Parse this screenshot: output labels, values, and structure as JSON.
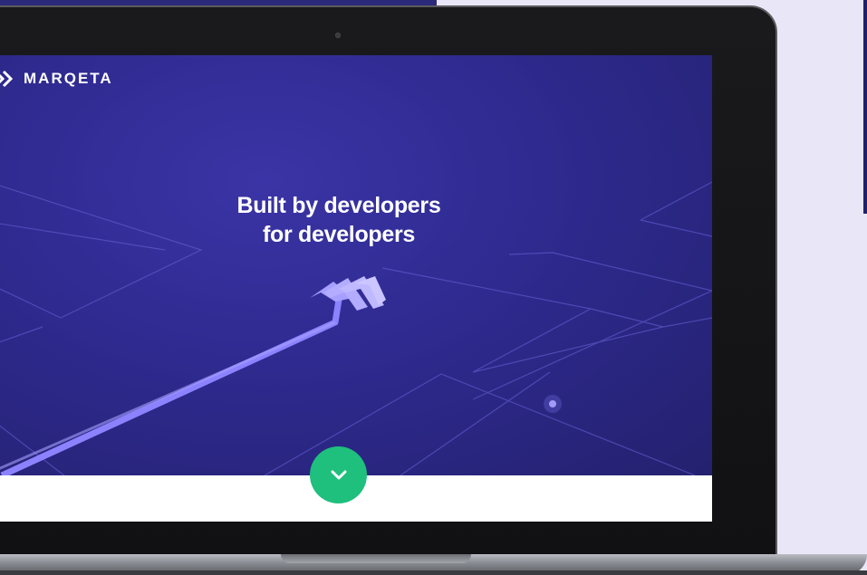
{
  "brand": {
    "name": "MARQETA",
    "logo_icon": "marqeta-chevrons-icon"
  },
  "hero": {
    "headline_line1": "Built by developers",
    "headline_line2": "for developers",
    "illustration_icon": "arrow-path-chevrons-icon"
  },
  "scroll_button": {
    "icon": "chevron-down-icon"
  },
  "colors": {
    "hero_background": "#2e2a8f",
    "line_accent": "#8c82ff",
    "scroll_button": "#1fbf7e",
    "text": "#ffffff"
  }
}
